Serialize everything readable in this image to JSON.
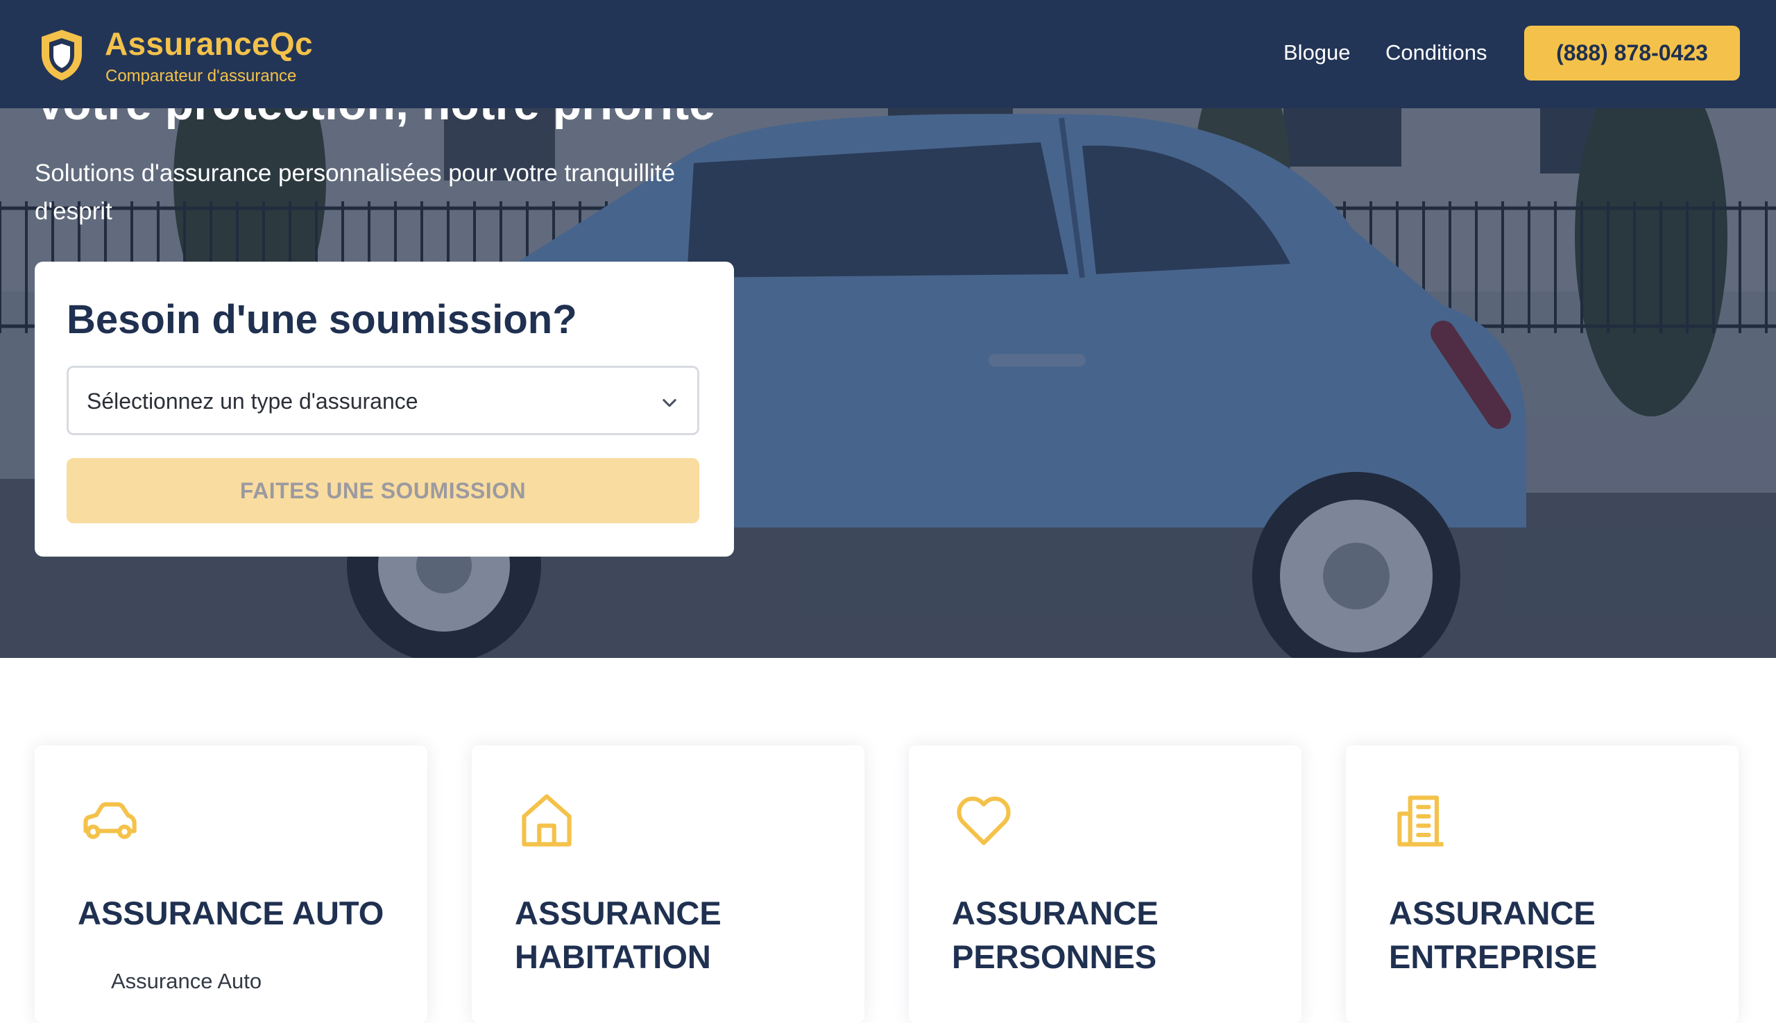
{
  "colors": {
    "navy": "#233557",
    "accent": "#f4c24a",
    "button_disabled": "#f9dc9f"
  },
  "header": {
    "brand_name": "AssuranceQc",
    "brand_tagline": "Comparateur d'assurance",
    "logo_icon": "shield-icon",
    "nav": [
      {
        "label": "Blogue"
      },
      {
        "label": "Conditions"
      }
    ],
    "phone": "(888) 878-0423"
  },
  "hero": {
    "title": "Votre protection, notre priorité",
    "subtitle": "Solutions d'assurance personnalisées pour votre tranquillité d'esprit"
  },
  "quote": {
    "title": "Besoin d'une soumission?",
    "select_placeholder": "Sélectionnez un type d'assurance",
    "select_icon": "chevron-down-icon",
    "submit_label": "FAITES UNE SOUMISSION"
  },
  "services": [
    {
      "icon": "car-icon",
      "title": "ASSURANCE AUTO",
      "sub": "Assurance Auto"
    },
    {
      "icon": "house-icon",
      "title": "ASSURANCE HABITATION",
      "sub": ""
    },
    {
      "icon": "heart-icon",
      "title": "ASSURANCE PERSONNES",
      "sub": ""
    },
    {
      "icon": "building-icon",
      "title": "ASSURANCE ENTREPRISE",
      "sub": ""
    }
  ]
}
